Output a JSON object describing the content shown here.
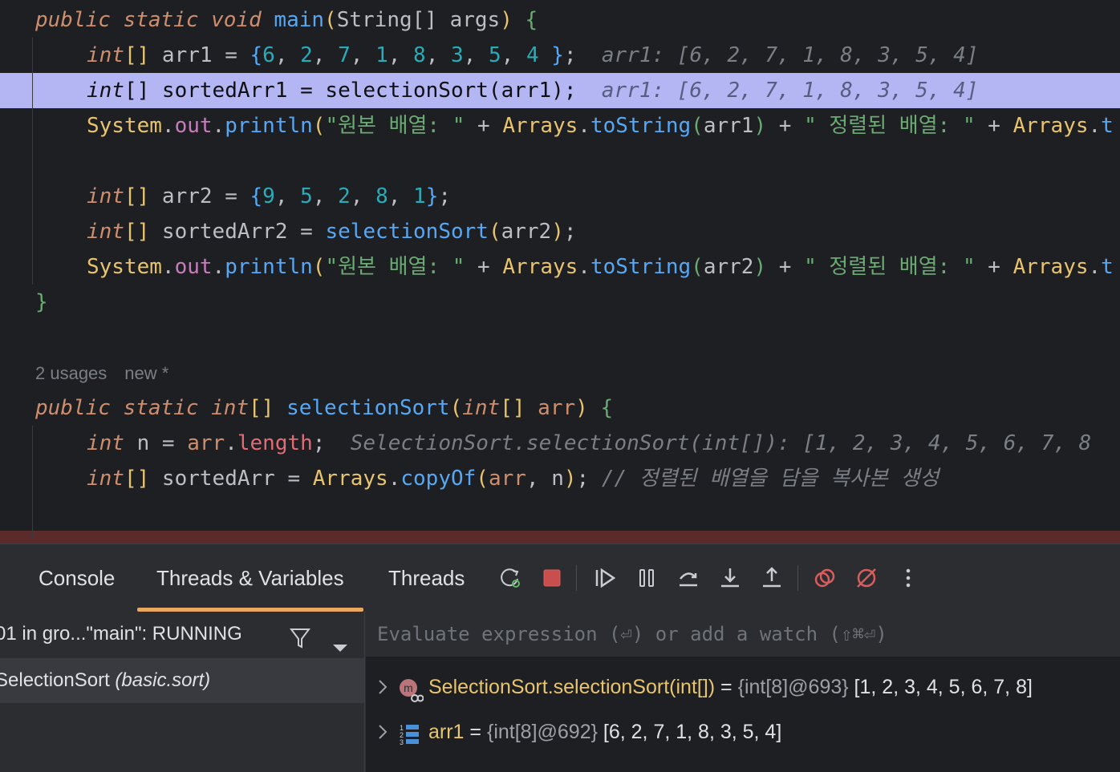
{
  "editor": {
    "usages": {
      "count": "2 usages",
      "tag": "new *"
    },
    "hints": {
      "arr1_decl": "arr1: [6, 2, 7, 1, 8, 3, 5, 4]",
      "arr1_current": "arr1: [6, 2, 7, 1, 8, 3, 5, 4]",
      "selection_return": "SelectionSort.selectionSort(int[]): [1, 2, 3, 4, 5, 6, 7, 8"
    },
    "comment": "// 정렬된 배열을 담을 복사본 생성"
  },
  "debug": {
    "tabs": [
      {
        "label": "Console"
      },
      {
        "label": "Threads & Variables"
      },
      {
        "label": "Threads"
      }
    ],
    "thread_selector": "01 in gro...\"main\": RUNNING",
    "frame": {
      "class": "SelectionSort",
      "package": "(basic.sort)"
    },
    "evaluate_placeholder": "Evaluate expression (⏎) or add a watch (⇧⌘⏎)",
    "variables": [
      {
        "name": "SelectionSort.selectionSort(int[])",
        "eq": " = ",
        "ref": "{int[8]@693}",
        "value": " [1, 2, 3, 4, 5, 6, 7, 8]",
        "icon": "method-return-icon"
      },
      {
        "name": "arr1",
        "eq": " = ",
        "ref": "{int[8]@692}",
        "value": " [6, 2, 7, 1, 8, 3, 5, 4]",
        "icon": "array-icon"
      }
    ]
  }
}
